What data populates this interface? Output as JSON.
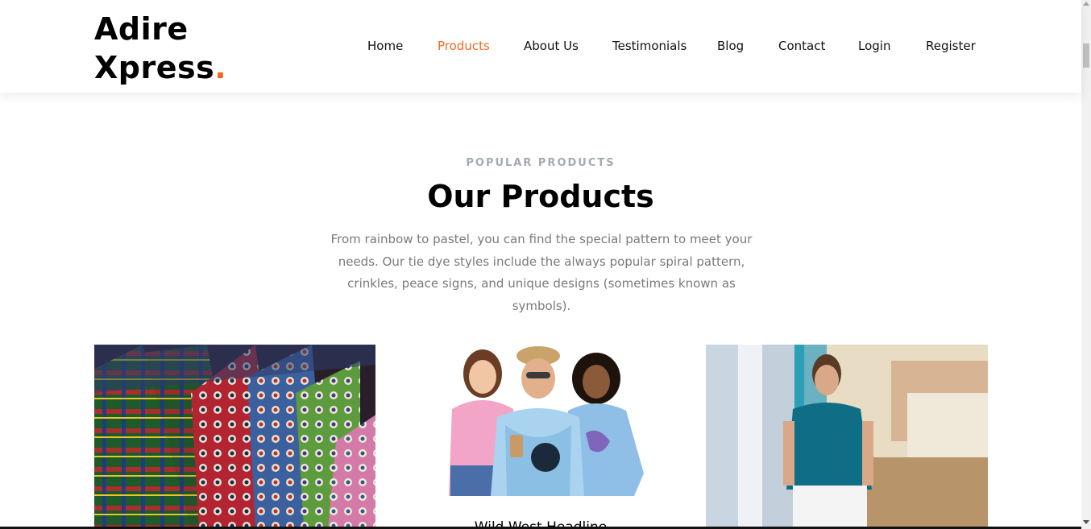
{
  "brand": {
    "line1": "Adire",
    "line2": "Xpress",
    "dot": ".",
    "accent_color": "#f26a21"
  },
  "nav": {
    "items": [
      {
        "label": "Home",
        "active": false
      },
      {
        "label": "Products",
        "active": true
      },
      {
        "label": "About Us",
        "active": false
      },
      {
        "label": "Testimonials",
        "active": false
      },
      {
        "label": "Blog",
        "active": false
      },
      {
        "label": "Contact",
        "active": false
      },
      {
        "label": "Login",
        "active": false
      },
      {
        "label": "Register",
        "active": false
      }
    ]
  },
  "products_section": {
    "eyebrow": "POPULAR PRODUCTS",
    "title": "Our Products",
    "description": "From rainbow to pastel, you can find the special pattern to meet your needs. Our tie dye styles include the always popular spiral pattern, crinkles, peace signs, and unique designs (sometimes known as symbols).",
    "cards": [
      {
        "image": "patterned-ties-photo"
      },
      {
        "image": "three-people-tie-dye-shirts-photo",
        "visible_title": "Wild West Headline"
      },
      {
        "image": "man-in-teal-tshirt-photo"
      }
    ]
  }
}
